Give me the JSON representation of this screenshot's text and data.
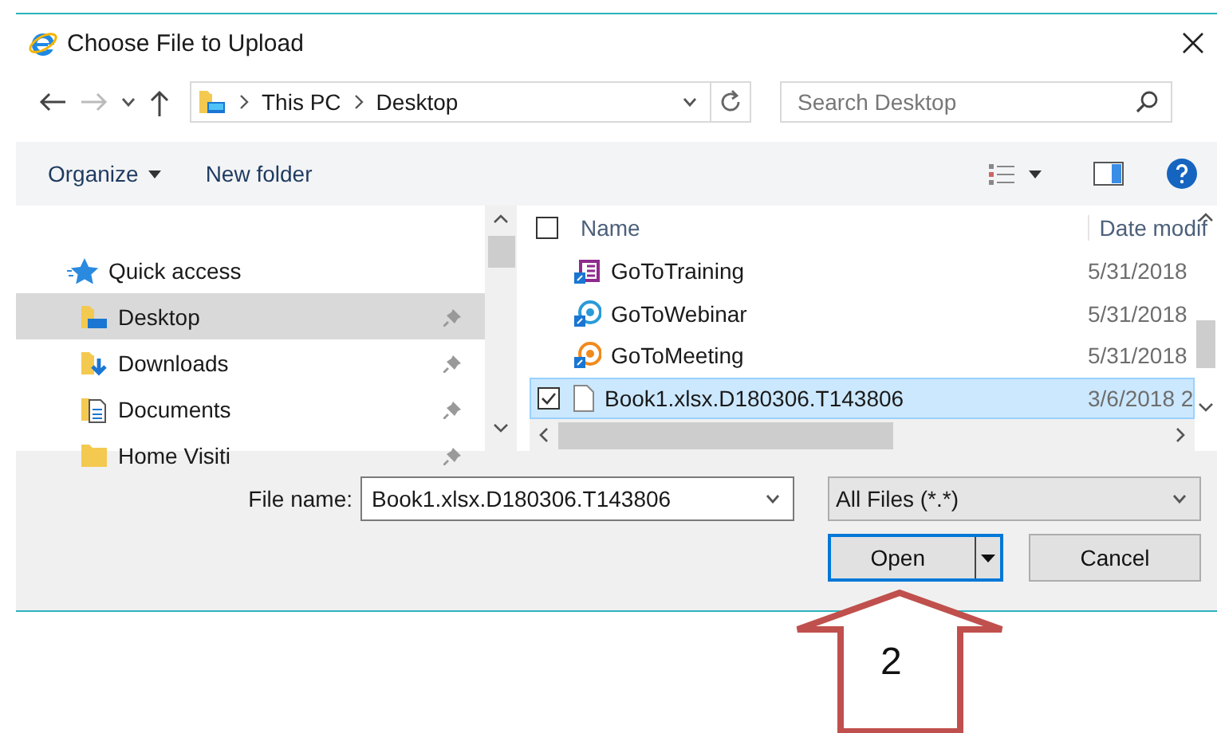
{
  "window": {
    "title": "Choose File to Upload"
  },
  "address_bar": {
    "path": [
      "This PC",
      "Desktop"
    ]
  },
  "search": {
    "placeholder": "Search Desktop"
  },
  "toolbar": {
    "organize": "Organize",
    "new_folder": "New folder"
  },
  "nav_pane": {
    "items": [
      {
        "label": "Quick access",
        "kind": "star",
        "selected": false,
        "pinned": false
      },
      {
        "label": "Desktop",
        "kind": "desktop",
        "selected": true,
        "pinned": true
      },
      {
        "label": "Downloads",
        "kind": "downloads",
        "selected": false,
        "pinned": true
      },
      {
        "label": "Documents",
        "kind": "documents",
        "selected": false,
        "pinned": true
      },
      {
        "label": "Home Visiti",
        "kind": "folder",
        "selected": false,
        "pinned": true
      }
    ]
  },
  "file_list": {
    "columns": [
      "Name",
      "Date modif"
    ],
    "header_checked": false,
    "rows": [
      {
        "name": "GoToTraining",
        "date": "5/31/2018",
        "kind": "training",
        "selected": false,
        "checked": false
      },
      {
        "name": "GoToWebinar",
        "date": "5/31/2018",
        "kind": "webinar",
        "selected": false,
        "checked": false
      },
      {
        "name": "GoToMeeting",
        "date": "5/31/2018",
        "kind": "meeting",
        "selected": false,
        "checked": false
      },
      {
        "name": "Book1.xlsx.D180306.T143806",
        "date": "3/6/2018 2",
        "kind": "file",
        "selected": true,
        "checked": true
      }
    ]
  },
  "bottom": {
    "file_name_label": "File name:",
    "file_name": "Book1.xlsx.D180306.T143806",
    "file_type": "All Files (*.*)",
    "open": "Open",
    "cancel": "Cancel"
  },
  "annotation": {
    "label": "2"
  }
}
